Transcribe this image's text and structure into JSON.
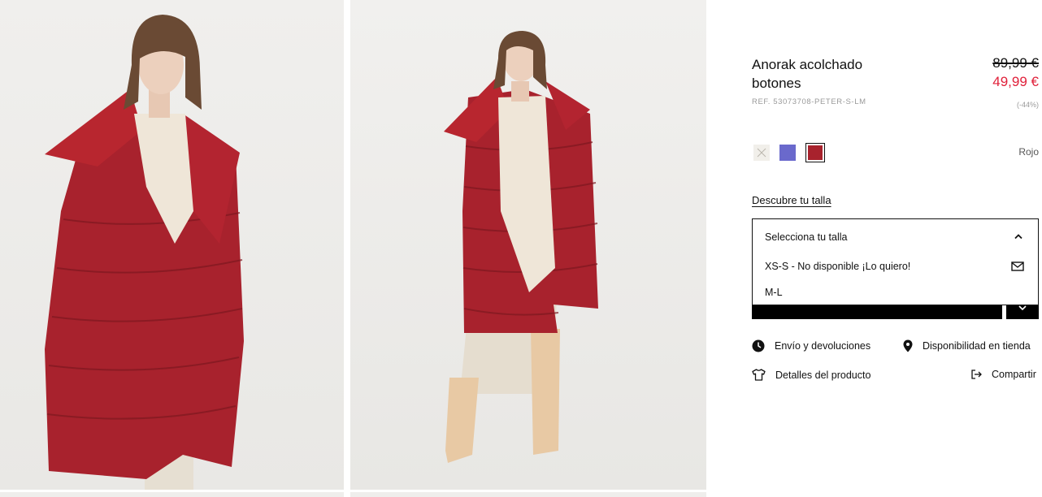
{
  "product": {
    "title": "Anorak acolchado botones",
    "reference": "REF. 53073708-PETER-S-LM",
    "price_original": "89,99 €",
    "price_sale": "49,99 €",
    "discount": "(-44%)"
  },
  "colors": {
    "swatches": [
      {
        "name": "cream",
        "hex": "#f1efea",
        "available": false
      },
      {
        "name": "blue",
        "hex": "#6a69cc",
        "available": true
      },
      {
        "name": "red",
        "hex": "#a8222d",
        "selected": true
      }
    ],
    "selected_label": "Rojo"
  },
  "size": {
    "guide_link": "Descubre tu talla",
    "placeholder": "Selecciona tu talla",
    "options": [
      {
        "label": "XS-S - No disponible ¡Lo quiero!",
        "available": false
      },
      {
        "label": "M-L",
        "available": true
      }
    ]
  },
  "links": {
    "shipping": "Envío y devoluciones",
    "store": "Disponibilidad en tienda",
    "details": "Detalles del producto",
    "share": "Compartir"
  },
  "theme": {
    "sale_color": "#e0203a",
    "coat_color": "#a8222d"
  }
}
